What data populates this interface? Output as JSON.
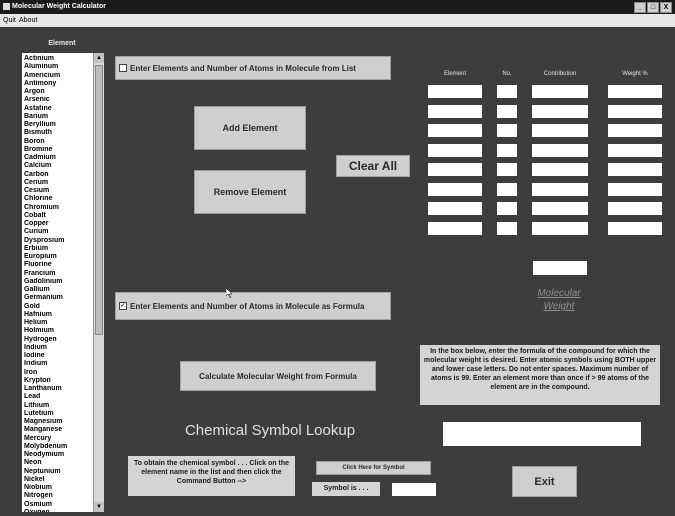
{
  "window": {
    "title": "Molecular Weight Calculator",
    "controls": [
      "_",
      "□",
      "X"
    ]
  },
  "menu": {
    "items": [
      "Quit",
      "About"
    ]
  },
  "element_list": {
    "header": "Element",
    "items": [
      "Actinium",
      "Aluminum",
      "Americium",
      "Antimony",
      "Argon",
      "Arsenic",
      "Astatine",
      "Barium",
      "Beryllium",
      "Bismuth",
      "Boron",
      "Bromine",
      "Cadmium",
      "Calcium",
      "Carbon",
      "Cerium",
      "Cesium",
      "Chlorine",
      "Chromium",
      "Cobalt",
      "Copper",
      "Curium",
      "Dysprosium",
      "Erbium",
      "Europium",
      "Fluorine",
      "Francium",
      "Gadolinium",
      "Gallium",
      "Germanium",
      "Gold",
      "Hafnium",
      "Helium",
      "Holmium",
      "Hydrogen",
      "Indium",
      "Iodine",
      "Iridium",
      "Iron",
      "Krypton",
      "Lanthanum",
      "Lead",
      "Lithium",
      "Lutetium",
      "Magnesium",
      "Manganese",
      "Mercury",
      "Molybdenum",
      "Neodymium",
      "Neon",
      "Neptunium",
      "Nickel",
      "Niobium",
      "Nitrogen",
      "Osmium",
      "Oxygen"
    ]
  },
  "list_entry": {
    "label": "Enter Elements and Number of Atoms in Molecule from List",
    "checked": false
  },
  "formula_entry": {
    "label": "Enter Elements and Number of Atoms in Molecule as Formula",
    "checked": true
  },
  "buttons": {
    "add_element": "Add Element",
    "remove_element": "Remove Element",
    "clear_all": "Clear All",
    "calculate": "Calculate Molecular Weight from Formula",
    "symbol": "Click Here for Symbol",
    "exit": "Exit"
  },
  "table": {
    "headers": [
      "Element",
      "No.",
      "Contribution",
      "Weight %"
    ],
    "rows": 8
  },
  "molecular_weight": {
    "label_line1": "Molecular",
    "label_line2": "Weight",
    "value": ""
  },
  "instructions": "In the box below, enter the formula of the compound for which the molecular weight is desired. Enter atomic symbols using BOTH upper and lower case letters. Do not enter spaces. Maximum number of atoms is 99. Enter an element more than once if > 99 atoms of the element are in the compound.",
  "formula_input": {
    "value": ""
  },
  "lookup": {
    "title": "Chemical Symbol Lookup",
    "help": "To obtain the chemical symbol . . . Click on the element name in the list and then click the Command Button -->",
    "symbol_label": "Symbol is . . .",
    "symbol_value": ""
  },
  "colors": {
    "background": "#3d3d3d",
    "button_face": "#cfcfcf",
    "field": "#ffffff"
  }
}
